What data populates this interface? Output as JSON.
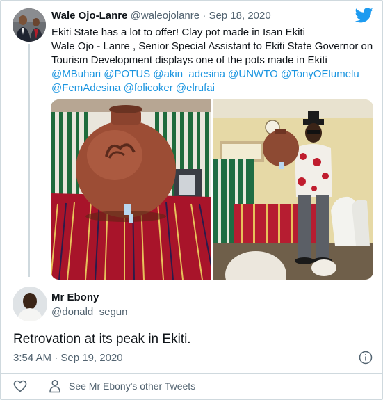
{
  "tweet1": {
    "display_name": "Wale Ojo-Lanre",
    "handle": "@waleojolanre",
    "separator": "·",
    "date": "Sep 18, 2020",
    "lines": [
      "Ekiti State has a lot to offer! Clay pot made in Isan Ekiti",
      "Wale Ojo - Lanre , Senior Special Assistant to Ekiti State Governor on",
      "Tourism Development displays one of the pots made in Ekiti"
    ],
    "mentions_line1": [
      "@MBuhari",
      "@POTUS",
      "@akin_adesina",
      "@UNWTO",
      "@TonyOElumelu"
    ],
    "mentions_line2": [
      "@FemAdesina",
      "@folicoker",
      "@elrufai"
    ]
  },
  "tweet2": {
    "display_name": "Mr Ebony",
    "handle": "@donald_segun",
    "text": "Retrovation at its peak in Ekiti.",
    "timestamp": "3:54 AM · Sep 19, 2020"
  },
  "footer": {
    "see_other": "See Mr Ebony's other Tweets"
  },
  "icons": {
    "brand": "twitter-bird-icon",
    "info": "info-icon",
    "like": "heart-icon",
    "profile": "person-icon"
  },
  "colors": {
    "brand": "#1d9bf0",
    "mention": "#1b95e0",
    "muted": "#536471"
  }
}
